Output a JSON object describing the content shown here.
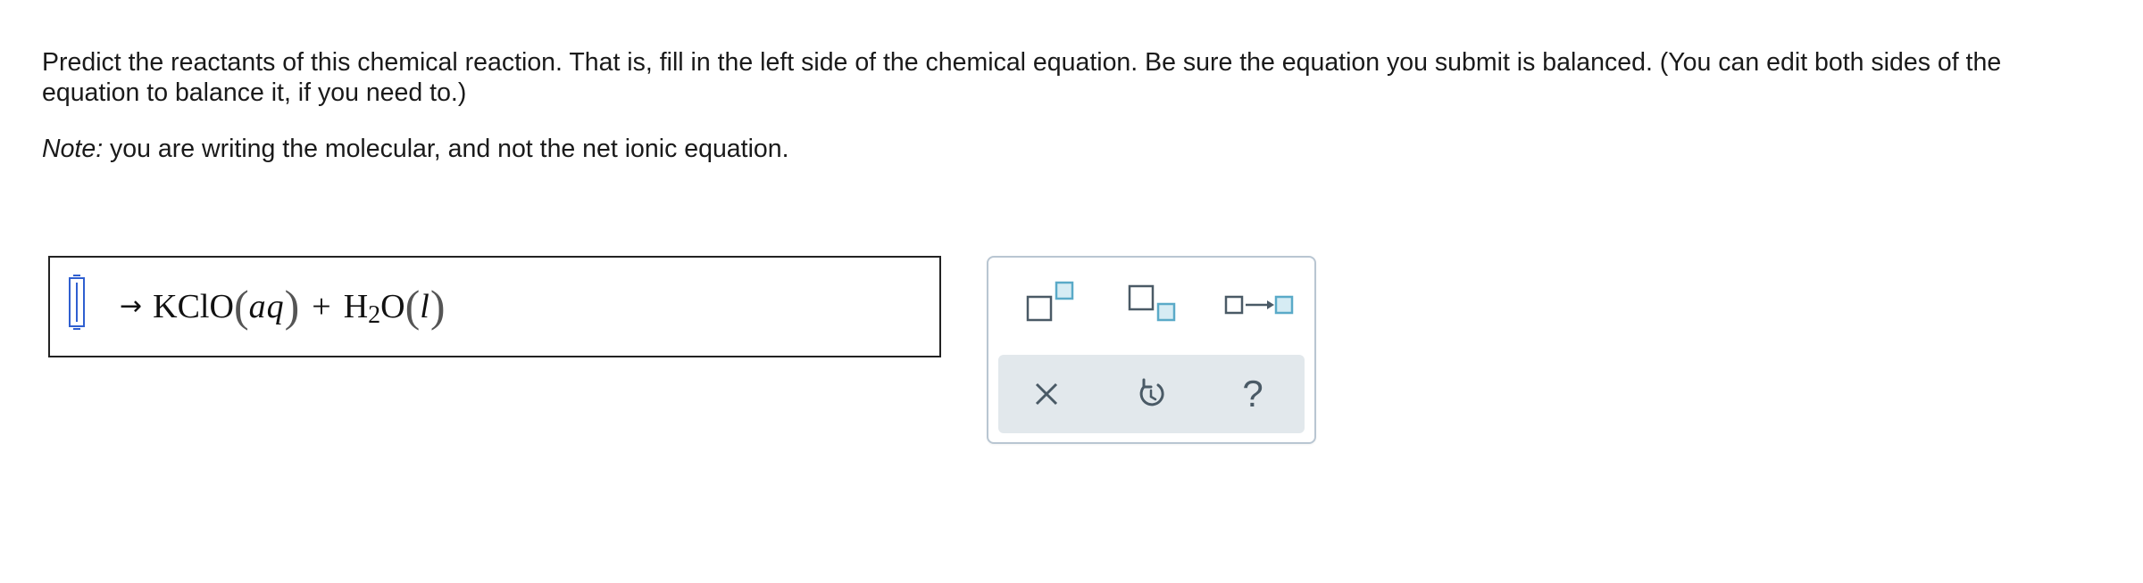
{
  "instructions": {
    "text": "Predict the reactants of this chemical reaction. That is, fill in the left side of the chemical equation. Be sure the equation you submit is balanced. (You can edit both sides of the equation to balance it, if you need to.)"
  },
  "note": {
    "label": "Note:",
    "text": " you are writing the molecular, and not the net ionic equation."
  },
  "equation": {
    "reactants_value": "",
    "arrow": "→",
    "product1_formula": "KClO",
    "product1_state": "aq",
    "plus": "+",
    "product2_formula_main": "H",
    "product2_subscript": "2",
    "product2_formula_tail": "O",
    "product2_state": "l",
    "paren_open": "(",
    "paren_close": ")"
  },
  "palette": {
    "tools": [
      "superscript-icon",
      "subscript-icon",
      "reaction-arrow-icon"
    ],
    "actions": {
      "clear_icon": "close-icon",
      "undo_icon": "undo-icon",
      "help_label": "?"
    },
    "accent_color": "#5aaac8",
    "icon_color": "#4a5a66"
  }
}
